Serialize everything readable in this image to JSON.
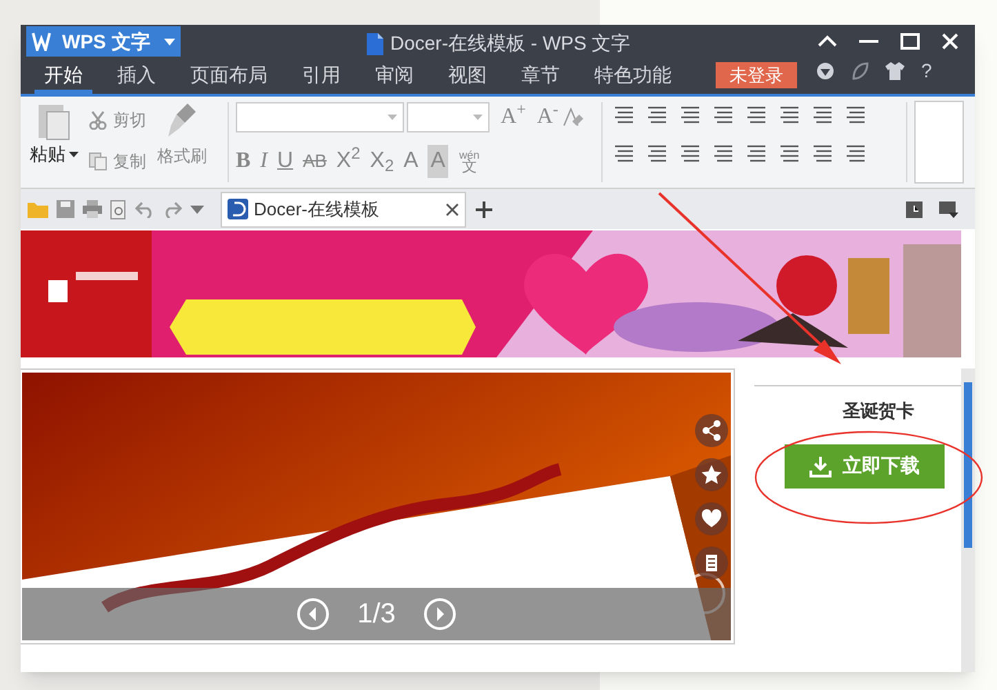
{
  "app_button": {
    "label": "WPS 文字"
  },
  "window": {
    "title": "Docer-在线模板 - WPS 文字"
  },
  "menu_tabs": [
    {
      "label": "开始",
      "selected": true
    },
    {
      "label": "插入",
      "selected": false
    },
    {
      "label": "页面布局",
      "selected": false
    },
    {
      "label": "引用",
      "selected": false
    },
    {
      "label": "审阅",
      "selected": false
    },
    {
      "label": "视图",
      "selected": false
    },
    {
      "label": "章节",
      "selected": false
    },
    {
      "label": "特色功能",
      "selected": false
    }
  ],
  "login_button": {
    "label": "未登录"
  },
  "help_button": {
    "label": "?"
  },
  "clipboard": {
    "paste": "粘贴",
    "cut": "剪切",
    "copy": "复制",
    "format_painter": "格式刷"
  },
  "font_row1": [
    {
      "label": "A$^{+}$"
    },
    {
      "label": "A$^{-}$"
    }
  ],
  "font_row2": [
    {
      "label": "B",
      "kind": "bold"
    },
    {
      "label": "I",
      "kind": "italic"
    },
    {
      "label": "U",
      "kind": "underline"
    },
    {
      "label": "AB",
      "kind": "strike"
    },
    {
      "label": "X$^{2}$",
      "kind": "plain"
    },
    {
      "label": "X$_{2}$",
      "kind": "plain"
    },
    {
      "label": "A",
      "kind": "plain"
    },
    {
      "label": "A",
      "kind": "shaded"
    }
  ],
  "phonetic": {
    "top": "wén",
    "bottom": "文"
  },
  "doc_tab": {
    "label": "Docer-在线模板"
  },
  "preview": {
    "page": "1/3"
  },
  "side_panel": {
    "title": "圣诞贺卡",
    "download": "立即下载"
  },
  "annotations": {
    "arrow": true,
    "ellipse": true
  }
}
